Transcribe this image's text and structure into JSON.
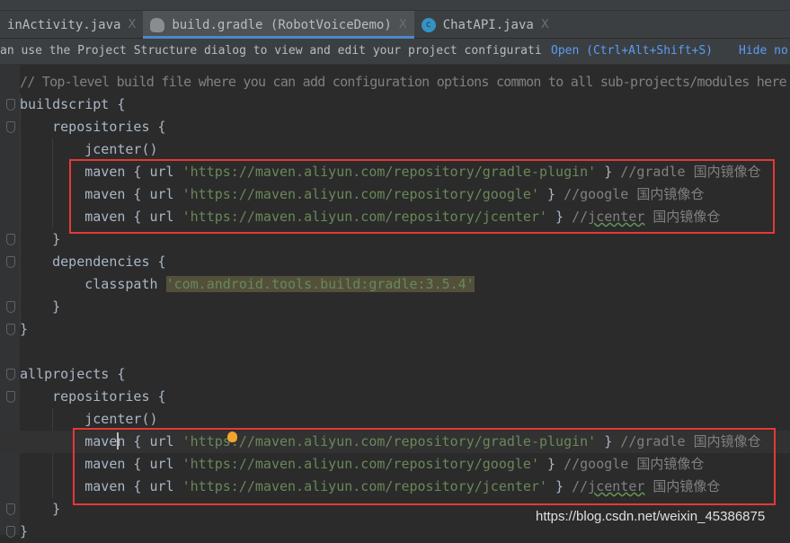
{
  "tabs": [
    {
      "label": "inActivity.java",
      "icon": "none",
      "active": false
    },
    {
      "label": "build.gradle (RobotVoiceDemo)",
      "icon": "gradle-elephant-icon",
      "active": true
    },
    {
      "label": "ChatAPI.java",
      "icon": "java-class-icon",
      "active": false
    }
  ],
  "tab_close": "X",
  "notice": {
    "text": "an use the Project Structure dialog to view and edit your project configurati",
    "open_link": "Open (Ctrl+Alt+Shift+S)",
    "hide_link": "Hide no"
  },
  "code": {
    "current_line": 16,
    "lines": [
      [
        [
          "comment",
          "// Top-level build file where you can add configuration options common to all sub-projects/modules here"
        ]
      ],
      [
        [
          "plain",
          "buildscript {"
        ]
      ],
      [
        [
          "plain",
          "    repositories {"
        ]
      ],
      [
        [
          "plain",
          "        jcenter()"
        ]
      ],
      [
        [
          "plain",
          "        maven { url "
        ],
        [
          "string",
          "'https://maven.aliyun.com/repository/gradle-plugin'"
        ],
        [
          "plain",
          " } "
        ],
        [
          "comment",
          "//gradle 国内镜像仓"
        ]
      ],
      [
        [
          "plain",
          "        maven { url "
        ],
        [
          "string",
          "'https://maven.aliyun.com/repository/google'"
        ],
        [
          "plain",
          " } "
        ],
        [
          "comment",
          "//google 国内镜像仓"
        ]
      ],
      [
        [
          "plain",
          "        maven { url "
        ],
        [
          "string",
          "'https://maven.aliyun.com/repository/jcenter'"
        ],
        [
          "plain",
          " } "
        ],
        [
          "comment",
          "//"
        ],
        [
          "comment-warn",
          "jcenter"
        ],
        [
          "comment",
          " 国内镜像仓"
        ]
      ],
      [
        [
          "plain",
          "    }"
        ]
      ],
      [
        [
          "plain",
          "    dependencies {"
        ]
      ],
      [
        [
          "plain",
          "        classpath "
        ],
        [
          "string-hl",
          "'com.android.tools.build:gradle:3.5.4'"
        ]
      ],
      [
        [
          "plain",
          "    }"
        ]
      ],
      [
        [
          "plain",
          "}"
        ]
      ],
      [
        [
          "plain",
          ""
        ]
      ],
      [
        [
          "plain",
          "allprojects {"
        ]
      ],
      [
        [
          "plain",
          "    repositories {"
        ]
      ],
      [
        [
          "plain",
          "        jcenter()"
        ]
      ],
      [
        [
          "plain",
          "        maven { url "
        ],
        [
          "string",
          "'https://maven.aliyun.com/repository/gradle-plugin'"
        ],
        [
          "plain",
          " } "
        ],
        [
          "comment",
          "//gradle 国内镜像仓"
        ]
      ],
      [
        [
          "plain",
          "        maven { url "
        ],
        [
          "string",
          "'https://maven.aliyun.com/repository/google'"
        ],
        [
          "plain",
          " } "
        ],
        [
          "comment",
          "//google 国内镜像仓"
        ]
      ],
      [
        [
          "plain",
          "        maven { url "
        ],
        [
          "string",
          "'https://maven.aliyun.com/repository/jcenter'"
        ],
        [
          "plain",
          " } "
        ],
        [
          "comment",
          "//"
        ],
        [
          "comment-warn",
          "jcenter"
        ],
        [
          "comment",
          " 国内镜像仓"
        ]
      ],
      [
        [
          "plain",
          "    }"
        ]
      ],
      [
        [
          "plain",
          "}"
        ]
      ]
    ],
    "fold_lines": [
      1,
      2,
      7,
      8,
      10,
      11,
      13,
      14,
      19,
      20
    ]
  },
  "watermark": "https://blog.csdn.net/weixin_45386875",
  "colors": {
    "background": "#2b2b2b",
    "string": "#6a8759",
    "comment": "#808080",
    "highlight_box": "#e53935",
    "link": "#589df6"
  }
}
